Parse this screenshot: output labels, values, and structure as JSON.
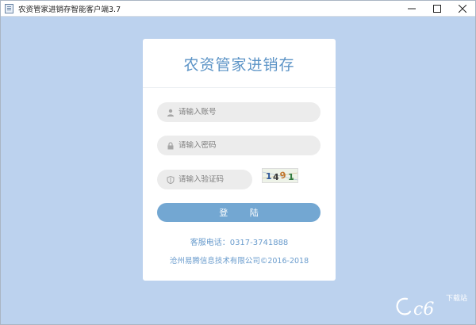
{
  "window": {
    "title": "农资管家进销存智能客户端3.7",
    "controls": {
      "minimize": "—",
      "maximize": "☐",
      "close": "✕"
    }
  },
  "login": {
    "title": "农资管家进销存",
    "account_placeholder": "请输入账号",
    "password_placeholder": "请输入密码",
    "code_placeholder": "请输入验证码",
    "captcha_text": "1491",
    "login_button": "登 陆",
    "phone": "客服电话：0317-3741888",
    "copyright": "沧州易腾信息技术有限公司©2016-2018"
  },
  "watermark": {
    "text": "pc6",
    "sub": "下载站"
  },
  "colors": {
    "background": "#bcd2ee",
    "accent": "#5b93c6",
    "button": "#73a7d2",
    "field": "#ececec"
  },
  "icons": {
    "account": "user-icon",
    "password": "lock-icon",
    "code": "shield-icon"
  }
}
